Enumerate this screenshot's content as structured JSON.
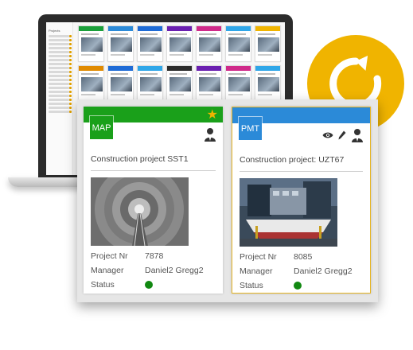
{
  "laptop_screen": {
    "sidebar_title": "Projects",
    "mini_card_colors": [
      "#1a9f3a",
      "#2b8ad8",
      "#1e6bd6",
      "#6a1fb0",
      "#d02a8a",
      "#2fa6e8",
      "#f0b400",
      "#e08a00",
      "#1e6bd6",
      "#2fa6e8",
      "#2b2b2b",
      "#6a1fb0",
      "#d02a8a",
      "#2fa6e8",
      "#e0a000",
      "#2fa6e8",
      "#33b24a",
      "#2b8ad8",
      "#1a9f3a",
      "#e03030",
      "#7a7a7a"
    ]
  },
  "refresh_icon": "refresh-icon",
  "cards": [
    {
      "badge": "MAP",
      "badge_color": "#1aa01a",
      "header_color": "#1aa01a",
      "title": "Construction project SST1",
      "project_nr_label": "Project Nr",
      "project_nr": "7878",
      "manager_label": "Manager",
      "manager": "Daniel2 Gregg2",
      "status_label": "Status",
      "status_color": "#118811",
      "icons": [
        "star-icon",
        "person-icon"
      ]
    },
    {
      "badge": "PMT",
      "badge_color": "#2b8ad8",
      "header_color": "#2b8ad8",
      "title": "Construction project: UZT67",
      "project_nr_label": "Project Nr",
      "project_nr": "8085",
      "manager_label": "Manager",
      "manager": "Daniel2 Gregg2",
      "status_label": "Status",
      "status_color": "#118811",
      "icons": [
        "eye-icon",
        "pencil-icon",
        "person-icon"
      ]
    }
  ]
}
